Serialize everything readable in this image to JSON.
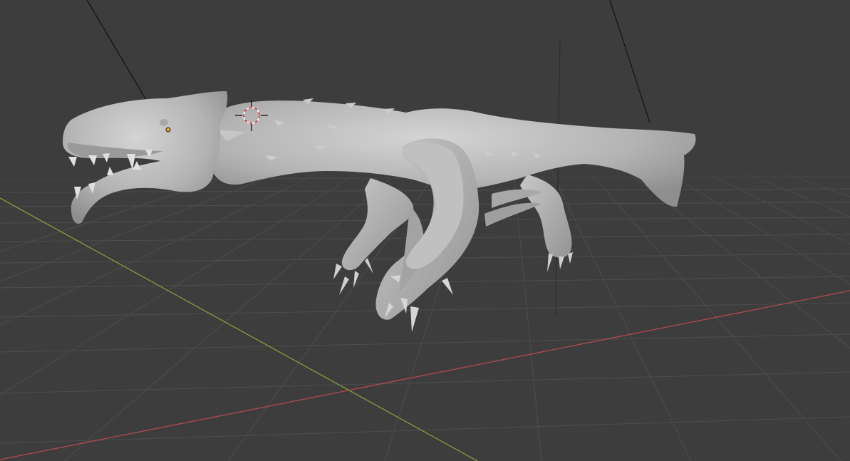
{
  "viewport": {
    "view": "perspective",
    "background_color": "#3d3d3d",
    "grid_color": "#4f4f4f",
    "x_axis_color": "#b44a4f",
    "y_axis_color": "#8a9a3a",
    "model_color": "#b9b9b9",
    "object": "creature-sculpt",
    "cursor": "3d-cursor-icon",
    "origin": "object-origin-icon",
    "light_lines": "light-direction-icon"
  }
}
